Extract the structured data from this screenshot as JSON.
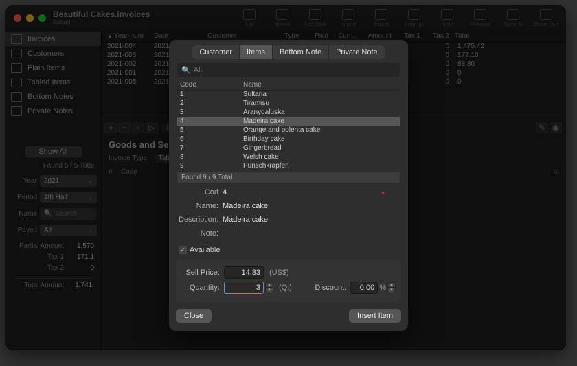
{
  "window": {
    "title": "Beautiful Cakes.invoices",
    "subtitle": "Edited"
  },
  "toolbar": [
    {
      "label": "Add"
    },
    {
      "label": "delete"
    },
    {
      "label": "Add Date"
    },
    {
      "label": "Import"
    },
    {
      "label": "Export"
    },
    {
      "label": "Settings"
    },
    {
      "label": "Input"
    },
    {
      "label": "Preview"
    },
    {
      "label": "Zoom In"
    },
    {
      "label": "Zoom Out"
    }
  ],
  "sidebar": {
    "items": [
      {
        "label": "Invoices"
      },
      {
        "label": "Customers"
      },
      {
        "label": "Plain Items"
      },
      {
        "label": "Tabled Items"
      },
      {
        "label": "Bottom Notes"
      },
      {
        "label": "Private Notes"
      }
    ]
  },
  "filters": {
    "show_all": "Show All",
    "found": "Found 5 / 5 Total",
    "year": {
      "label": "Year",
      "value": "2021"
    },
    "period": {
      "label": "Period",
      "value": "1th Half"
    },
    "name": {
      "label": "Name",
      "placeholder": "Search"
    },
    "payed": {
      "label": "Payed",
      "value": "All"
    }
  },
  "totals": {
    "partial": {
      "label": "Partial Amount",
      "value": "1,570"
    },
    "tax1": {
      "label": "Tax 1",
      "value": "171.1"
    },
    "tax2": {
      "label": "Tax 2",
      "value": "0"
    },
    "total": {
      "label": "Total Amount",
      "value": "1,741."
    }
  },
  "grid": {
    "year_col": "Year-num",
    "date_col": "Date",
    "customer_col": "Customer",
    "type_col": "Type",
    "paid_col": "Paid",
    "curr_col": "Curr...",
    "amount_col": "Amount",
    "tax1_col": "Tax 1",
    "tax2_col": "Tax 2",
    "total_col": "Total",
    "rows": [
      {
        "year": "2021-004",
        "date": "2021/",
        "tax2": "0",
        "total": "1,475.42"
      },
      {
        "year": "2021-003",
        "date": "2021/",
        "tax2": "0",
        "total": "177.10"
      },
      {
        "year": "2021-002",
        "date": "2021/",
        "tax2": "0",
        "total": "88.80"
      },
      {
        "year": "2021-001",
        "date": "2021/",
        "tax2": "0",
        "total": "0"
      },
      {
        "year": "2021-005",
        "date": "2021/",
        "tax2": "0",
        "total": "0"
      }
    ]
  },
  "detail": {
    "found_tab": "Found",
    "heading": "Goods and Serv",
    "invoice_type_label": "Invoice Type:",
    "invoice_type_value": "Tab",
    "col_hash": "#",
    "col_code": "Code",
    "col_net": "ot"
  },
  "sheet": {
    "tabs": {
      "customer": "Customer",
      "items": "Items",
      "bottom": "Bottom Note",
      "private": "Private Note"
    },
    "search_placeholder": "All",
    "items_head": {
      "code": "Code",
      "name": "Name"
    },
    "items": [
      {
        "code": "1",
        "name": "Sultana"
      },
      {
        "code": "2",
        "name": "Tiramisu"
      },
      {
        "code": "3",
        "name": "Aranygaluska"
      },
      {
        "code": "4",
        "name": "Madeira cake"
      },
      {
        "code": "5",
        "name": "Orange and polenta cake"
      },
      {
        "code": "6",
        "name": "Birthday cake"
      },
      {
        "code": "7",
        "name": "Gingerbread"
      },
      {
        "code": "8",
        "name": "Welsh cake"
      },
      {
        "code": "9",
        "name": "Punschkrapfen"
      }
    ],
    "found": "Found 9 / 9 Total",
    "form": {
      "code_label": "Cod",
      "code_value": "4",
      "name_label": "Name:",
      "name_value": "Madeira cake",
      "desc_label": "Description:",
      "desc_value": "Madeira cake",
      "note_label": "Note:",
      "available_label": "Available",
      "sell_label": "Sell Price:",
      "sell_value": "14.33",
      "sell_unit": "(US$)",
      "qty_label": "Quantity:",
      "qty_value": "3",
      "qty_unit": "(Qt)",
      "disc_label": "Discount:",
      "disc_value": "0,00",
      "disc_unit": "%"
    },
    "buttons": {
      "close": "Close",
      "insert": "Insert Item"
    }
  }
}
